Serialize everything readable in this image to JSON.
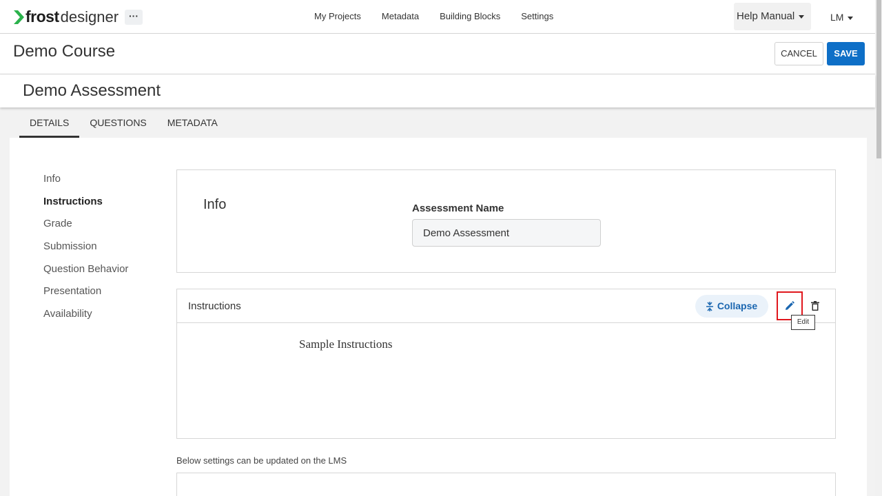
{
  "app": {
    "logo_bold": "frost",
    "logo_light": "designer",
    "more_label": "···"
  },
  "topnav": {
    "items": [
      "My Projects",
      "Metadata",
      "Building Blocks",
      "Settings"
    ],
    "help_label": "Help Manual",
    "user_initials": "LM"
  },
  "course": {
    "title": "Demo Course",
    "cancel_label": "CANCEL",
    "save_label": "SAVE"
  },
  "assessment": {
    "title": "Demo Assessment",
    "tabs": [
      "DETAILS",
      "QUESTIONS",
      "METADATA"
    ],
    "active_tab": "DETAILS"
  },
  "sidebar": {
    "items": [
      "Info",
      "Instructions",
      "Grade",
      "Submission",
      "Question Behavior",
      "Presentation",
      "Availability"
    ],
    "active": "Instructions"
  },
  "info_panel": {
    "heading": "Info",
    "name_label": "Assessment Name",
    "name_value": "Demo Assessment"
  },
  "instructions_panel": {
    "title": "Instructions",
    "collapse_label": "Collapse",
    "edit_tooltip": "Edit",
    "body_text": "Sample Instructions"
  },
  "lms_note": "Below settings can be updated on the LMS",
  "colors": {
    "primary": "#0e6fc7",
    "highlight_box": "#e0161c",
    "logo_green": "#2bb24c"
  }
}
